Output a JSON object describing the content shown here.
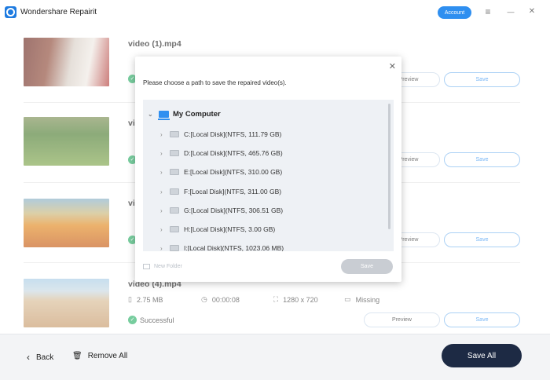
{
  "app": {
    "title": "Wondershare Repairit",
    "account_label": "Account",
    "menu_icon": "≡",
    "minimize_icon": "—",
    "close_icon": "✕"
  },
  "videos": [
    {
      "name": "video (1).mp4",
      "size": "",
      "duration": "",
      "resolution": "",
      "audio": "",
      "status": "",
      "preview_label": "Preview",
      "save_label": "Save"
    },
    {
      "name": "vi",
      "size": "",
      "duration": "",
      "resolution": "",
      "audio": "",
      "status": "",
      "preview_label": "Preview",
      "save_label": "Save"
    },
    {
      "name": "vi",
      "size": "",
      "duration": "",
      "resolution": "",
      "audio": "",
      "status": "",
      "preview_label": "Preview",
      "save_label": "Save"
    },
    {
      "name": "video (4).mp4",
      "size": "2.75  MB",
      "duration": "00:00:08",
      "resolution": "1280 x 720",
      "audio": "Missing",
      "status": "Successful",
      "preview_label": "Preview",
      "save_label": "Save"
    }
  ],
  "bottom": {
    "back_label": "Back",
    "remove_all_label": "Remove All",
    "save_all_label": "Save All"
  },
  "dialog": {
    "message": "Please choose a path to save the repaired video(s).",
    "root_label": "My Computer",
    "drives": [
      "C:[Local Disk](NTFS, 111.79  GB)",
      "D:[Local Disk](NTFS, 465.76  GB)",
      "E:[Local Disk](NTFS, 310.00  GB)",
      "F:[Local Disk](NTFS, 311.00  GB)",
      "G:[Local Disk](NTFS, 306.51  GB)",
      "H:[Local Disk](NTFS, 3.00  GB)",
      "I:[Local Disk](NTFS, 1023.06  MB)"
    ],
    "new_folder_label": "New Folder",
    "save_label": "Save"
  }
}
